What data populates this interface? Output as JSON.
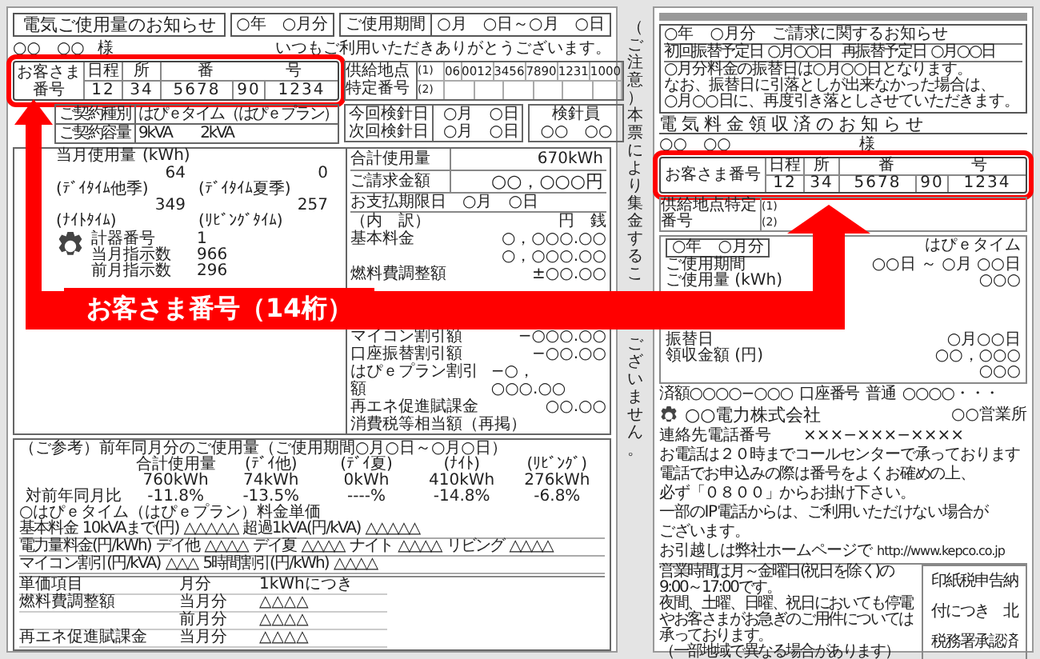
{
  "left_slip": {
    "title": "電気ご使用量のお知らせ",
    "month": "○年　○月分",
    "period_label": "ご使用期間",
    "period_value": "○月　○日～○月　○日",
    "customer_name": "○○　○○",
    "honorific": "様",
    "greeting": "いつもご利用いただきありがとうございます。",
    "customer_number": {
      "label": "お客さま番号",
      "highlighted": true,
      "headers": [
        "日程",
        "所",
        "番",
        "号"
      ],
      "values": [
        "12",
        "34",
        "5678",
        "90",
        "1234"
      ]
    },
    "supply_point": {
      "label": "供給地点特定番号",
      "rows": [
        {
          "index": "(1)",
          "values": [
            "06",
            "0012",
            "3456",
            "7890",
            "1231",
            "1000"
          ]
        },
        {
          "index": "(2)"
        }
      ]
    },
    "contract": [
      {
        "label": "ご契約種別",
        "value": "はぴｅタイム（はぴｅプラン）"
      },
      {
        "label": "ご契約容量",
        "value": "9kVA　　2kVA"
      }
    ],
    "meter_dates": [
      {
        "label": "今回検針日",
        "value": "○月　○日"
      },
      {
        "label": "次回検針日",
        "value": "○月　○日"
      }
    ],
    "reader": {
      "label": "検針員",
      "value": "○○　○○"
    },
    "usage": {
      "label": "当月使用量",
      "unit": "(kWh)",
      "items": [
        {
          "value": "64",
          "sublabel": "(ﾃﾞｲﾀｲﾑ他季)"
        },
        {
          "value": "0",
          "sublabel": "(ﾃﾞｲﾀｲﾑ夏季)"
        },
        {
          "value": "349",
          "sublabel": "(ﾅｲﾄﾀｲﾑ)"
        },
        {
          "value": "257",
          "sublabel": "(ﾘﾋﾞﾝｸﾞﾀｲﾑ)"
        }
      ],
      "meter": [
        {
          "label": "計器番号",
          "value": "1"
        },
        {
          "label": "当月指示数",
          "value": "966"
        },
        {
          "label": "前月指示数",
          "value": "296"
        }
      ]
    },
    "billing": {
      "total_label": "合計使用量",
      "total": "670kWh",
      "amount_label": "ご請求金額",
      "amount": "○○，○○○円",
      "due_label": "お支払期限日",
      "due": "○月　○日",
      "breakdown_label": "（内　訳）",
      "unit": "円　銭",
      "items_before": [
        {
          "label": "基本料金",
          "value": "○，○○○.○○"
        },
        {
          "value": "○，○○○.○○"
        },
        {
          "label": "燃料費調整額",
          "value": "±○○.○○"
        }
      ],
      "items_after": [
        {
          "label": "マイコン割引額",
          "value": "−○○○.○○"
        },
        {
          "label": "口座振替割引額",
          "value": "−○○.○○"
        },
        {
          "label": "はぴｅプラン割引額",
          "value": "−○，○○○.○○"
        },
        {
          "label": "再エネ促進賦課金",
          "value": "○○.○○"
        },
        {
          "label": "消費税等相当額（再掲）"
        }
      ]
    },
    "reference": {
      "title": "（ご参考）前年同月分のご使用量（ご使用期間○月○日～○月○日）",
      "headers": [
        "合計使用量",
        "(ﾃﾞｲ他)",
        "(ﾃﾞｲ夏)",
        "(ﾅｲﾄ)",
        "(ﾘﾋﾞﾝｸﾞ)"
      ],
      "usage": [
        "760kWh",
        "74kWh",
        "0kWh",
        "410kWh",
        "276kWh"
      ],
      "ratio_label": "対前年同月比",
      "ratio": [
        "-11.8%",
        "-13.5%",
        "----%",
        "-14.8%",
        "-6.8%"
      ],
      "tariff_title": "○はぴｅタイム（はぴｅプラン）料金単価",
      "tariff_rows": [
        [
          "基本料金",
          "10kVAまで(円)",
          "△△△△△",
          "超過1kVA(円/kVA)",
          "△△△△△"
        ],
        [
          "電力量料金(円/kWh)",
          "デイ他",
          "△△△△",
          "デイ夏",
          "△△△△",
          "ナイト",
          "△△△△",
          "リビング",
          "△△△△"
        ],
        [
          "マイコン割引(円/kVA)",
          "△△△",
          "5時間割引(円/kWh)",
          "△△△△"
        ]
      ],
      "unit_rows": [
        [
          "単価項目",
          "月分",
          "1kWhにつき"
        ],
        [
          "燃料費調整額",
          "当月分",
          "△△△△"
        ],
        [
          "",
          "前月分",
          "△△△△"
        ],
        [
          "再エネ促進賦課金",
          "当月分",
          "△△△△"
        ]
      ]
    }
  },
  "notice_parts": [
    "（ご注意）本票により集金するこ",
    "ございません。"
  ],
  "right_slip": {
    "notice": {
      "title": "○年　○月分　ご請求に関するお知らせ",
      "dates": [
        {
          "label": "初回振替予定日",
          "value": "○月○○日"
        },
        {
          "label": "再振替予定日",
          "value": "○月○○日"
        }
      ],
      "lines": [
        "○月分料金の振替日は○月○○日となります。",
        "なお、振替日に引落としが出来なかった場合は、",
        "○月○○日に、再度引き落としさせていただきます。"
      ]
    },
    "receipt_title": "電気料金領収済のお知らせ",
    "customer_name": "○○　○○",
    "honorific": "様",
    "customer_number": {
      "label": "お客さま番号",
      "highlighted": true,
      "headers": [
        "日程",
        "所",
        "番",
        "号"
      ],
      "values": [
        "12",
        "34",
        "5678",
        "90",
        "1234"
      ]
    },
    "supply_point": {
      "label": "供給地点特定番号",
      "indexes": [
        "(1)",
        "(2)"
      ]
    },
    "period": {
      "month": "○年　○月分",
      "plan": "はぴｅタイム",
      "rows": [
        {
          "label": "ご使用期間",
          "value": "○○日 ～ ○月 ○○日"
        },
        {
          "label": "ご使用量 (kWh)",
          "value": "○○○"
        },
        {
          "label": "振替日",
          "value": "○月○○日"
        },
        {
          "label": "領収金額 (円)",
          "value": "○○，○○○"
        },
        {
          "value": "○○○"
        }
      ]
    },
    "bank": [
      "済額○○○○−○○○",
      "口座番号",
      "普通",
      "○○○○・・・"
    ],
    "company": {
      "name": "○○電力株式会社",
      "office": "○○営業所",
      "phone_label": "連絡先電話番号",
      "phone": "×××−×××−××××"
    },
    "messages": [
      "お電話は２０時までコールセンターで承っております",
      "電話でお申込みの際は番号をよくお確めの上、",
      "必ず「０８００」からお掛け下さい。",
      "一部のIP電話からは、ご利用いただけない場合が",
      "ございます。"
    ],
    "website": {
      "text": "お引越しは弊社ホームページで",
      "url": "http://www.kepco.co.jp"
    },
    "hours": [
      "営業時間は月～金曜日(祝日を除く)の9:00～17:00です。",
      "夜間、土曜、日曜、祝日においても停電やお客さまがお急ぎのご用件については承っております。",
      "（一部地域で異なる場合があります）"
    ],
    "stamp": [
      "印紙税申告納",
      "付につき　北",
      "税務署承認済"
    ]
  },
  "callout": {
    "label": "お客さま番号（14桁）"
  }
}
